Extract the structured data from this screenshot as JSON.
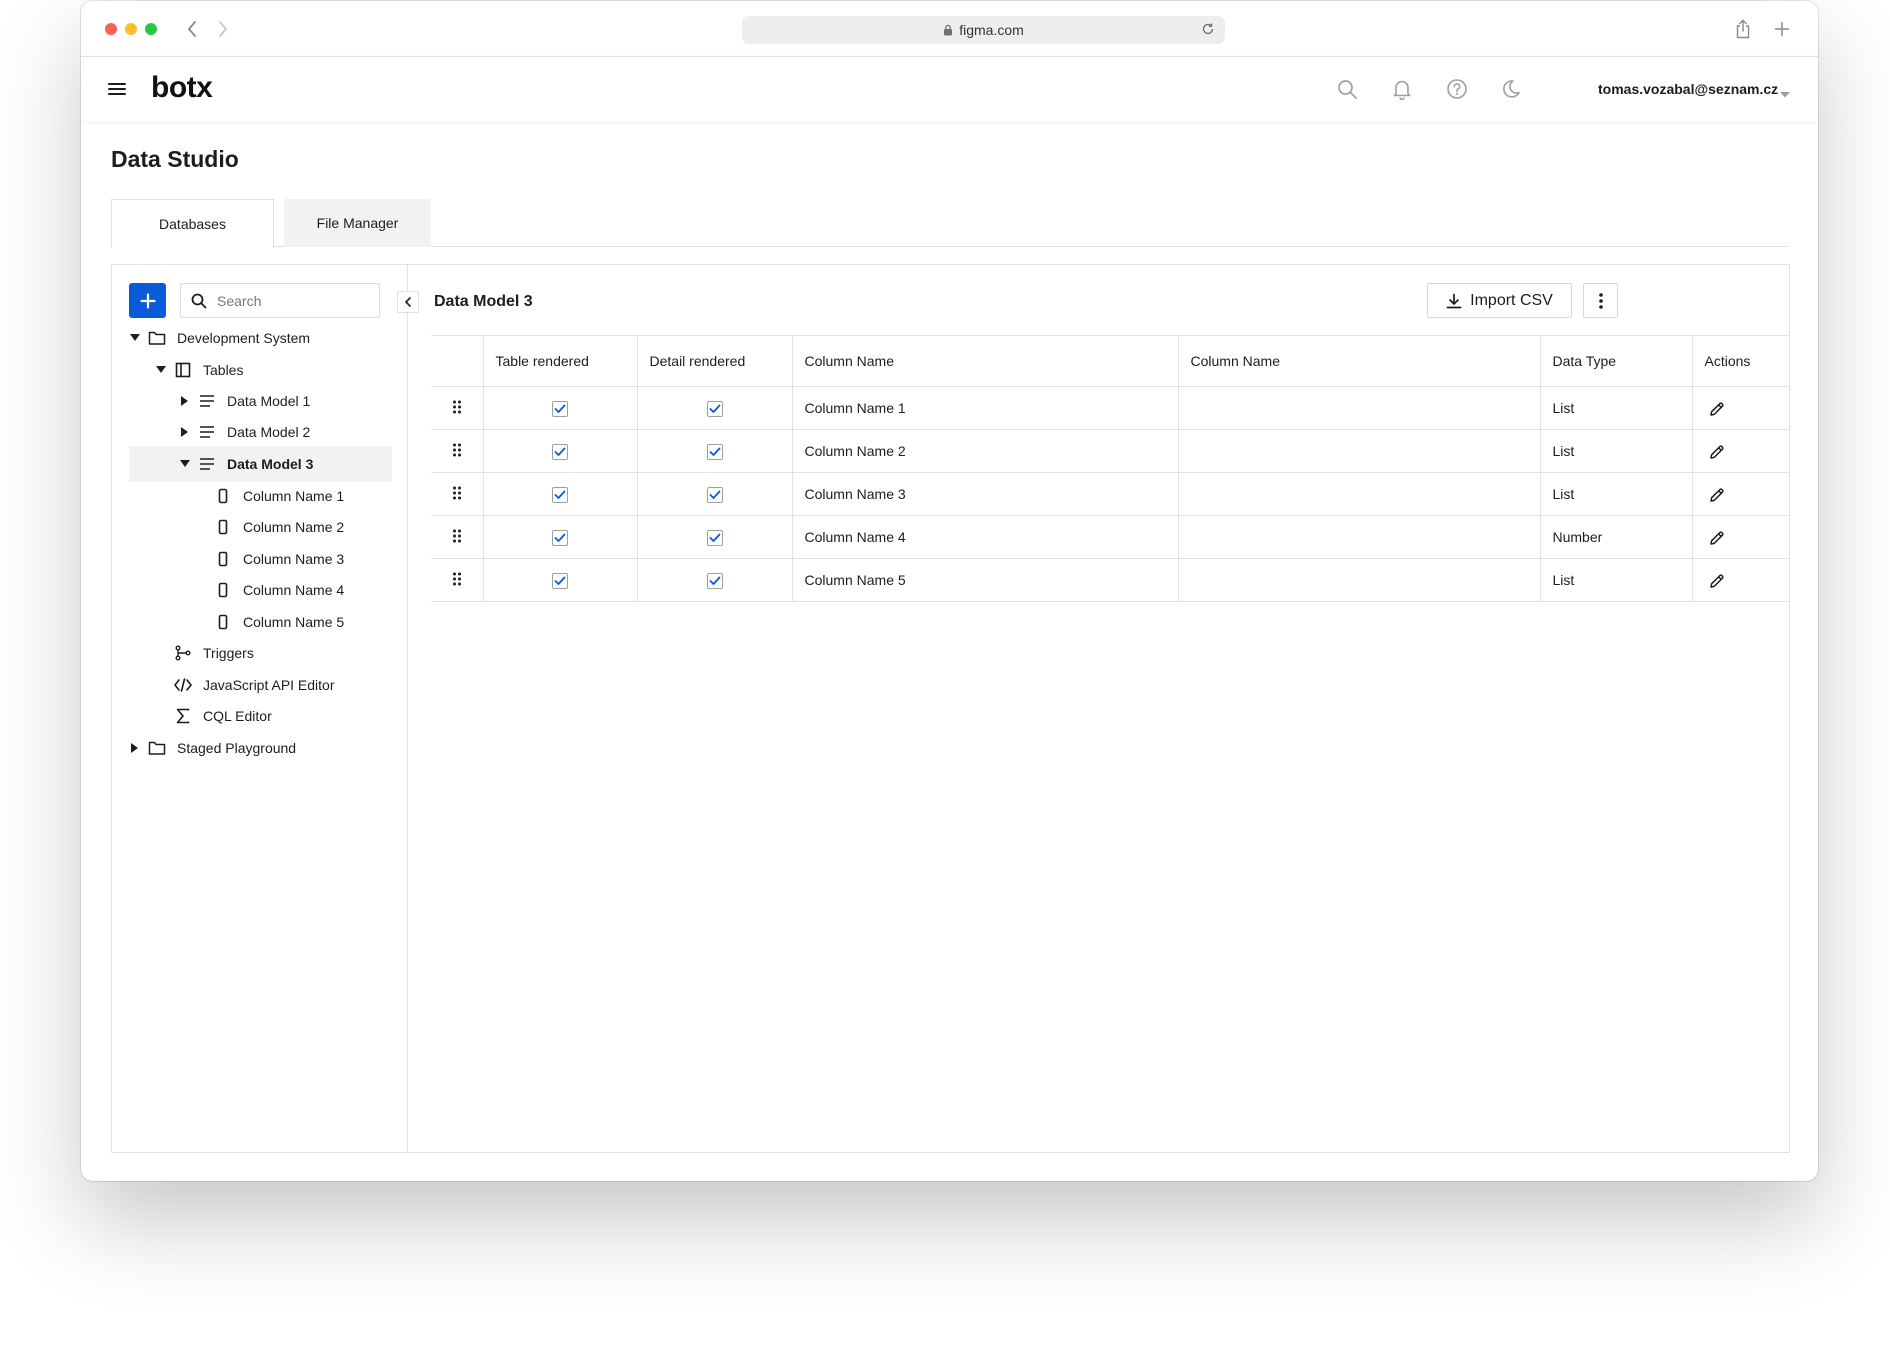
{
  "browser": {
    "url": "figma.com"
  },
  "app": {
    "logo": "botx",
    "user_email": "tomas.vozabal@seznam.cz"
  },
  "page": {
    "title": "Data Studio",
    "tabs": [
      "Databases",
      "File Manager"
    ],
    "active_tab": "Databases"
  },
  "sidebar": {
    "search_placeholder": "Search",
    "tree": [
      {
        "label": "Development System",
        "icon": "folder-icon",
        "expanded": true
      },
      {
        "label": "Tables",
        "icon": "table-icon",
        "expanded": true
      },
      {
        "label": "Data Model 1",
        "icon": "list-icon",
        "expanded": false
      },
      {
        "label": "Data Model 2",
        "icon": "list-icon",
        "expanded": false
      },
      {
        "label": "Data Model 3",
        "icon": "list-icon",
        "expanded": true,
        "selected": true
      },
      {
        "label": "Column Name 1",
        "icon": "column-icon"
      },
      {
        "label": "Column Name 2",
        "icon": "column-icon"
      },
      {
        "label": "Column Name 3",
        "icon": "column-icon"
      },
      {
        "label": "Column Name 4",
        "icon": "column-icon"
      },
      {
        "label": "Column Name 5",
        "icon": "column-icon"
      },
      {
        "label": "Triggers",
        "icon": "trigger-icon"
      },
      {
        "label": "JavaScript API Editor",
        "icon": "code-icon"
      },
      {
        "label": "CQL Editor",
        "icon": "sigma-icon"
      },
      {
        "label": "Staged Playground",
        "icon": "folder-icon",
        "expanded": false
      }
    ]
  },
  "main": {
    "title": "Data Model 3",
    "import_label": "Import CSV",
    "columns": [
      "",
      "Table rendered",
      "Detail rendered",
      "Column Name",
      "Column Name",
      "Data Type",
      "Actions"
    ],
    "rows": [
      {
        "table_rendered": true,
        "detail_rendered": true,
        "column_name": "Column Name 1",
        "column_name_2": "",
        "data_type": "List"
      },
      {
        "table_rendered": true,
        "detail_rendered": true,
        "column_name": "Column Name 2",
        "column_name_2": "",
        "data_type": "List"
      },
      {
        "table_rendered": true,
        "detail_rendered": true,
        "column_name": "Column Name 3",
        "column_name_2": "",
        "data_type": "List"
      },
      {
        "table_rendered": true,
        "detail_rendered": true,
        "column_name": "Column Name 4",
        "column_name_2": "",
        "data_type": "Number"
      },
      {
        "table_rendered": true,
        "detail_rendered": true,
        "column_name": "Column Name 5",
        "column_name_2": "",
        "data_type": "List"
      }
    ]
  },
  "colors": {
    "primary": "#0a5bd8",
    "selected_bg": "#f1f2f4",
    "border": "#e2e2e2"
  }
}
